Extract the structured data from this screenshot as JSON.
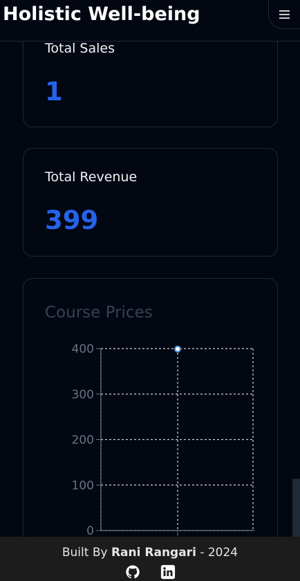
{
  "header": {
    "title": "Holistic Well-being",
    "menu_icon": "hamburger-icon"
  },
  "stats": {
    "sales": {
      "label": "Total Sales",
      "value": "1"
    },
    "revenue": {
      "label": "Total Revenue",
      "value": "399"
    }
  },
  "colors": {
    "accent": "#2563eb",
    "background": "#030712",
    "card_border": "#1f2937",
    "footer_bg": "#1c1c1c"
  },
  "chart": {
    "title": "Course Prices"
  },
  "chart_data": {
    "type": "line",
    "title": "Course Prices",
    "categories": [
      ""
    ],
    "series": [
      {
        "values": [
          399
        ]
      }
    ],
    "ylim": [
      0,
      400
    ],
    "yticks": [
      "0",
      "100",
      "200",
      "300",
      "400"
    ],
    "grid": true,
    "point_color": "#4b8fd6"
  },
  "footer": {
    "built_by": "Built By",
    "author": "Rani Rangari",
    "year_suffix": "- 2024",
    "icons": [
      "github-icon",
      "linkedin-icon"
    ]
  }
}
